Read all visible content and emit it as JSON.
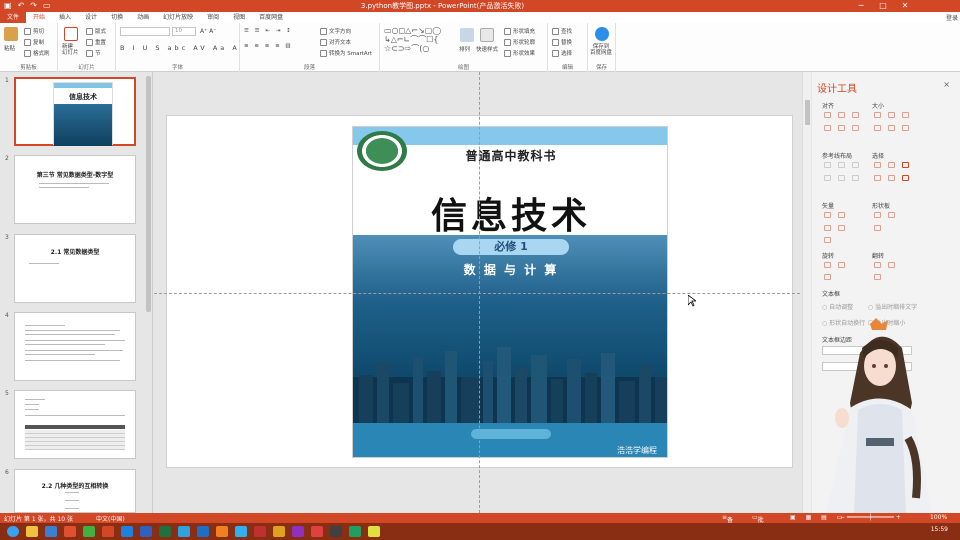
{
  "title_bar": {
    "title": "3.python教学图.pptx - PowerPoint(产品激活失败)",
    "login": "登录",
    "quick_access": [
      "save-icon",
      "undo-icon",
      "redo-icon",
      "present-icon"
    ],
    "window_buttons": [
      "─",
      "□",
      "✕"
    ]
  },
  "ribbon_tabs": [
    "文件",
    "开始",
    "插入",
    "设计",
    "切换",
    "动画",
    "幻灯片放映",
    "审阅",
    "视图",
    "百度网盘"
  ],
  "ribbon_tab_active": 1,
  "ribbon": {
    "clipboard": {
      "label": "剪贴板",
      "paste": "粘贴",
      "cut": "剪切",
      "copy": "复制",
      "painter": "格式刷"
    },
    "slides": {
      "label": "幻灯片",
      "new_slide": "新建\n幻灯片",
      "layout": "版式",
      "reset": "重置",
      "section": "节"
    },
    "font": {
      "label": "字体",
      "size": "10"
    },
    "paragraph": {
      "label": "段落",
      "text_dir": "文字方向",
      "align_text": "对齐文本",
      "smartart": "转换为 SmartArt"
    },
    "drawing": {
      "label": "绘图",
      "arrange": "排列",
      "quick_styles": "快速样式",
      "fill": "形状填充",
      "outline": "形状轮廓",
      "effects": "形状效果"
    },
    "editing": {
      "label": "编辑",
      "find": "查找",
      "replace": "替换",
      "select": "选择"
    },
    "save": {
      "label": "保存",
      "save_baidu": "保存到\n百度网盘"
    }
  },
  "slides": [
    {
      "num": "1",
      "title": "信息技术",
      "kind": "cover"
    },
    {
      "num": "2",
      "title": "第三节 常见数据类型-数字型",
      "kind": "text"
    },
    {
      "num": "3",
      "title": "2.1 常见数据类型",
      "kind": "text"
    },
    {
      "num": "4",
      "title": "",
      "kind": "dense"
    },
    {
      "num": "5",
      "title": "",
      "kind": "table"
    },
    {
      "num": "6",
      "title": "2.2 几种类型的互相转换",
      "kind": "text"
    }
  ],
  "slide_content": {
    "banner": "普通高中教科书",
    "main_title": "信息技术",
    "badge": "必修 1",
    "subtitle": "数 据 与 计 算",
    "watermark": "浩浩学编程"
  },
  "design_pane": {
    "title": "设计工具",
    "close": "×",
    "sections": {
      "align": "对齐",
      "size": "大小",
      "ref_layout": "参考线布局",
      "select": "选择",
      "arrow": "矢量",
      "shape_lib": "形状板",
      "rotate": "旋转",
      "flip": "翻转",
      "textbox": "文本框",
      "textbox_margin": "文本框边距"
    },
    "textbox_options": [
      "自动调整",
      "溢出时缩排文字",
      "形状自动换行",
      "溢出时缩小"
    ]
  },
  "status_bar": {
    "slide_info": "幻灯片 第 1 张，共 10 张",
    "language": "中文(中国)",
    "notes": "备注",
    "comments": "批注",
    "zoom": "100%"
  },
  "taskbar": {
    "clock": "15:59"
  },
  "colors": {
    "accent": "#d24726",
    "slide_blue": "#1a5a82"
  }
}
